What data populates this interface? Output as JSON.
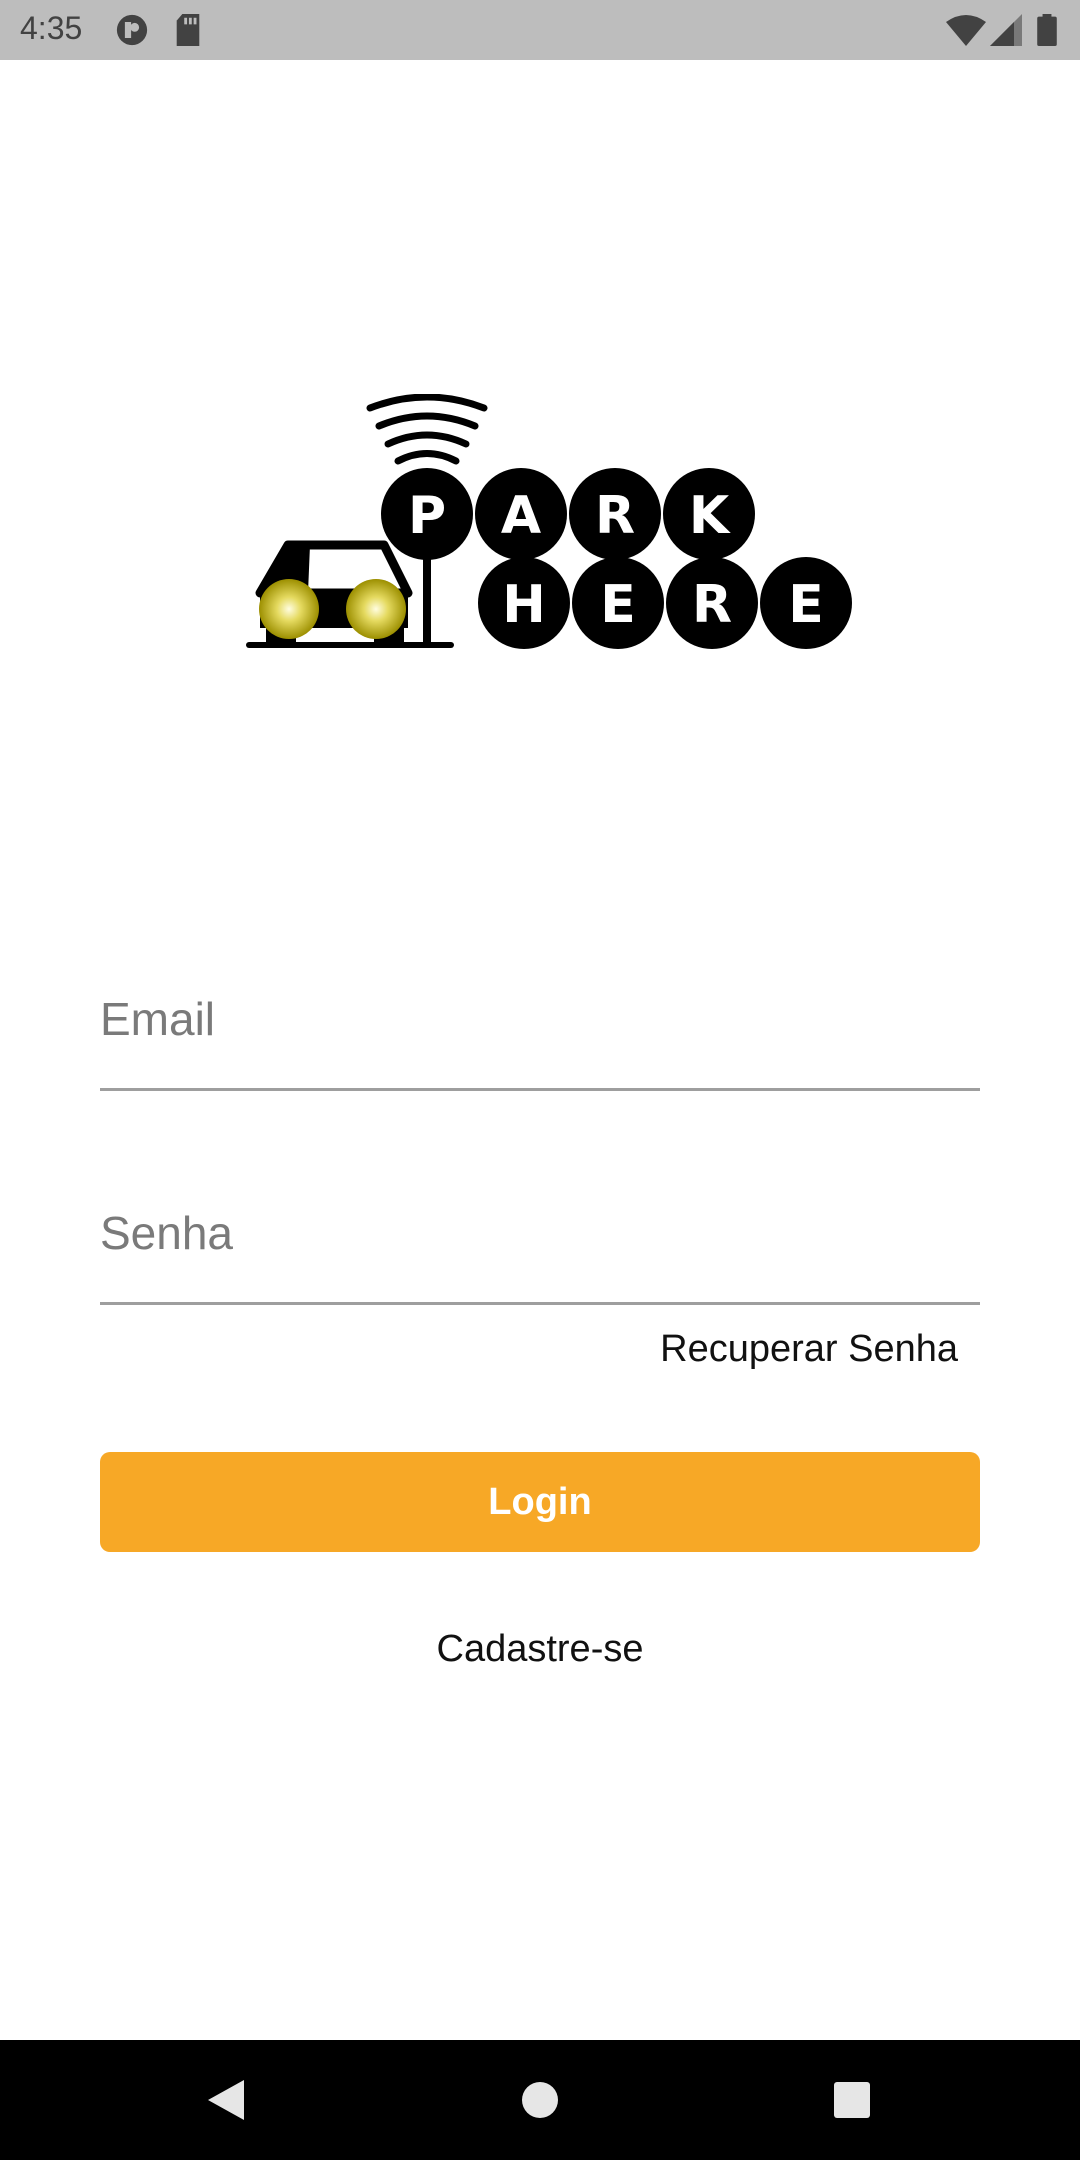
{
  "status_bar": {
    "time": "4:35",
    "icons": [
      "app-notification-icon",
      "sd-card-icon",
      "wifi-icon",
      "signal-icon",
      "battery-icon"
    ]
  },
  "logo": {
    "row1_letters": [
      "P",
      "A",
      "R",
      "K"
    ],
    "row2_letters": [
      "H",
      "E",
      "R",
      "E"
    ],
    "alt": "Park Here"
  },
  "form": {
    "email_placeholder": "Email",
    "email_value": "",
    "password_placeholder": "Senha",
    "password_value": "",
    "recover_label": "Recuperar Senha",
    "login_label": "Login",
    "signup_label": "Cadastre-se"
  },
  "nav": {
    "icons": [
      "back-icon",
      "home-icon",
      "recents-icon"
    ]
  },
  "colors": {
    "accent": "#f7a826",
    "status_bar": "#bdbdbd",
    "headlight": "#d4c600"
  }
}
